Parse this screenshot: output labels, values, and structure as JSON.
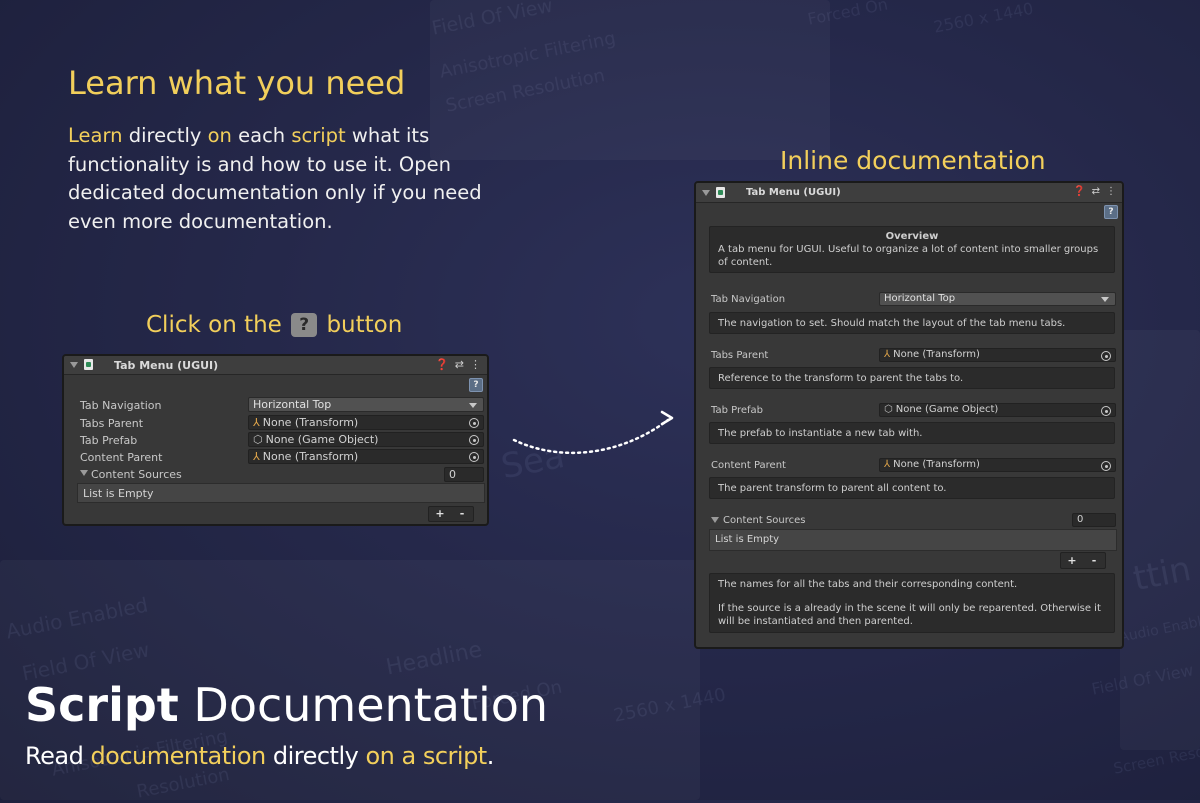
{
  "colors": {
    "accent": "#f2cf5b",
    "background": "#25284a",
    "inspector_bg": "#383838"
  },
  "background_words": [
    "Field Of View",
    "Anisotropic Filtering",
    "Screen Resolution",
    "Forced On",
    "2560 x 1440",
    "Audio Enabled",
    "Field Of View",
    "Headline",
    "Forced On",
    "2560 x 1440",
    "Anisotropic Filtering",
    "Resolution",
    "Sea",
    "Field Of View",
    "Audio Enabled",
    "Screen Resolution",
    "ttin"
  ],
  "learn": {
    "headline": "Learn what you need",
    "lead_parts": [
      "Learn",
      " directly ",
      "on",
      " each ",
      "script",
      " what its functionality is and how to use it. Open dedicated documentation only if you need even more documentation."
    ]
  },
  "click_caption": {
    "before": "Click on the",
    "button": "?",
    "after": "button"
  },
  "inline_caption": "Inline documentation",
  "small_inspector": {
    "title": "Tab Menu (UGUI)",
    "header_icons": [
      "help-icon",
      "preset-icon",
      "more-icon"
    ],
    "help_button": "?",
    "fields": [
      {
        "label": "Tab Navigation",
        "value": "Horizontal Top",
        "kind": "dropdown"
      },
      {
        "label": "Tabs Parent",
        "value": "None (Transform)",
        "kind": "object",
        "icon": "transform-icon"
      },
      {
        "label": "Tab Prefab",
        "value": "None (Game Object)",
        "kind": "object",
        "icon": "gameobject-icon"
      },
      {
        "label": "Content Parent",
        "value": "None (Transform)",
        "kind": "object",
        "icon": "transform-icon"
      }
    ],
    "list": {
      "label": "Content Sources",
      "count": "0",
      "empty_text": "List is Empty",
      "add": "+",
      "remove": "-"
    }
  },
  "large_inspector": {
    "title": "Tab Menu (UGUI)",
    "help_button": "?",
    "overview_title": "Overview",
    "overview_text": "A tab menu for UGUI. Useful to organize a lot of content into smaller groups of content.",
    "fields": [
      {
        "label": "Tab Navigation",
        "value": "Horizontal Top",
        "kind": "dropdown",
        "help": "The navigation to set. Should match the layout of the tab menu tabs."
      },
      {
        "label": "Tabs Parent",
        "value": "None (Transform)",
        "kind": "object",
        "help": "Reference to the transform to parent the tabs to."
      },
      {
        "label": "Tab Prefab",
        "value": "None (Game Object)",
        "kind": "object",
        "help": "The prefab to instantiate a new tab with."
      },
      {
        "label": "Content Parent",
        "value": "None (Transform)",
        "kind": "object",
        "help": "The parent transform to parent all content to."
      }
    ],
    "list": {
      "label": "Content Sources",
      "count": "0",
      "empty_text": "List is Empty",
      "add": "+",
      "remove": "-",
      "help_1": "The names for all the tabs and their corresponding content.",
      "help_2": "If the source is a already in the scene it will only be reparented. Otherwise it will be instantiated and then parented."
    }
  },
  "footer": {
    "title_bold": "Script",
    "title_rest": " Documentation",
    "subtitle_parts": [
      "Read ",
      "documentation",
      " directly ",
      "on a script",
      "."
    ]
  }
}
